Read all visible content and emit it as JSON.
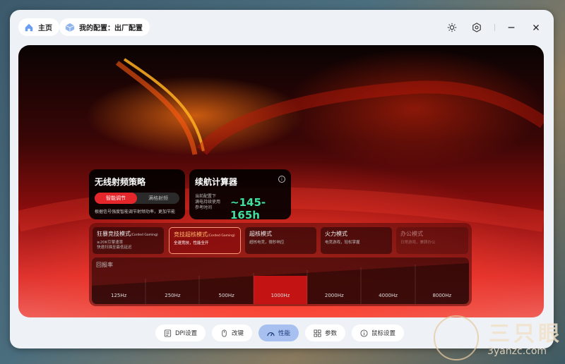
{
  "topbar": {
    "home_label": "主页",
    "config_label": "我的配置：出厂配置",
    "icons": [
      "brightness-icon",
      "settings-icon",
      "minimize-icon",
      "close-icon"
    ]
  },
  "rf_card": {
    "title": "无线射频策略",
    "options": [
      "智能调节",
      "满格射频"
    ],
    "active_option": "智能调节",
    "description": "根据信号强度智能调节射频功率，更加节能"
  },
  "battery_card": {
    "title": "续航计算器",
    "subtitle_lines": [
      "当前配置下",
      "满电持续使用",
      "参考时间"
    ],
    "value": "~145-165h",
    "value_color": "#3fe0a0"
  },
  "modes": [
    {
      "name": "狂暴竞技模式",
      "tag": "(Corded Gaming)",
      "desc_lines": [
        "≥20K引擎速率",
        "快速扫描至最低延迟"
      ]
    },
    {
      "name": "竞技超核模式",
      "tag": "(Corded Gaming)",
      "desc_lines": [
        "全速竞技，性能全开"
      ],
      "active": true
    },
    {
      "name": "超核模式",
      "tag": "",
      "desc_lines": [
        "超核电竞，微秒响应"
      ]
    },
    {
      "name": "火力模式",
      "tag": "",
      "desc_lines": [
        "电竞游戏，轻松掌握"
      ]
    },
    {
      "name": "办公模式",
      "tag": "",
      "desc_lines": [
        "日常游戏，兼顾办公"
      ],
      "disabled": true
    }
  ],
  "polling_rate": {
    "label": "回报率",
    "options": [
      "125Hz",
      "250Hz",
      "500Hz",
      "1000Hz",
      "2000Hz",
      "4000Hz",
      "8000Hz"
    ],
    "selected": "1000Hz"
  },
  "bottom_tabs": [
    {
      "label": "DPI设置",
      "icon": "dpi-icon"
    },
    {
      "label": "改键",
      "icon": "mouse-icon"
    },
    {
      "label": "性能",
      "icon": "performance-icon",
      "active": true
    },
    {
      "label": "参数",
      "icon": "grid-icon"
    },
    {
      "label": "鼠标设置",
      "icon": "info-icon"
    }
  ],
  "watermark": {
    "text": "三只眼",
    "url": "3yanzc.com"
  },
  "colors": {
    "accent": "#e5262a",
    "active_tab_bg": "#a8c0f0"
  }
}
